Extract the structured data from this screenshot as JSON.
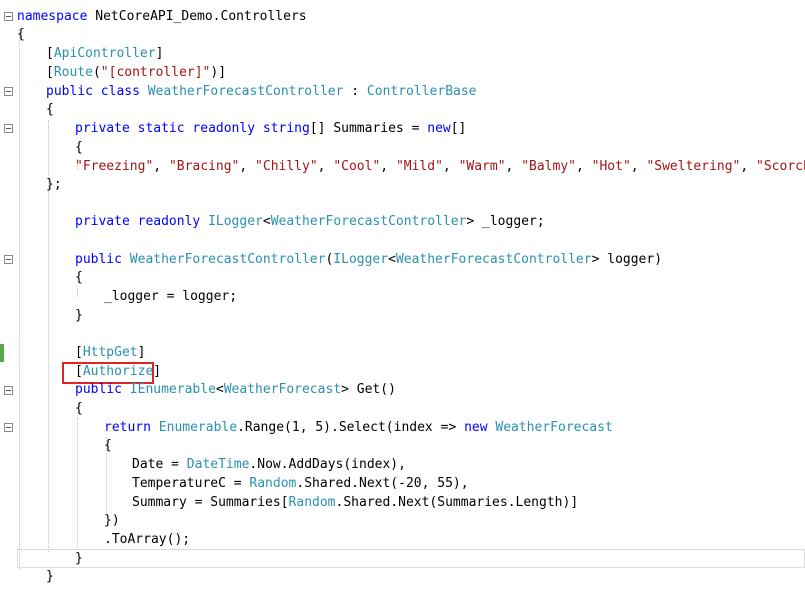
{
  "editor": {
    "colors": {
      "keyword": "#0000ff",
      "type": "#2b91af",
      "string": "#a31515",
      "text": "#000000",
      "highlight_box": "#e02424",
      "change_indicator": "#57a64a"
    },
    "lines": [
      {
        "text_a": "namespace",
        "text_b": " NetCoreAPI_Demo.Controllers"
      },
      {
        "text": "{"
      },
      {
        "p1": "[",
        "t1": "ApiController",
        "p2": "]"
      },
      {
        "p1": "[",
        "t1": "Route",
        "p2": "(",
        "s1": "\"[controller]\"",
        "p3": ")]"
      },
      {
        "k1": "public",
        "k2": "class",
        "t1": "WeatherForecastController",
        "p1": " : ",
        "t2": "ControllerBase"
      },
      {
        "text": "{"
      },
      {
        "k1": "private",
        "k2": "static",
        "k3": "readonly",
        "k4": "string",
        "p1": "[] Summaries = ",
        "k5": "new",
        "p2": "[]"
      },
      {
        "text": "{"
      },
      {
        "s1": "\"Freezing\"",
        "s2": "\"Bracing\"",
        "s3": "\"Chilly\"",
        "s4": "\"Cool\"",
        "s5": "\"Mild\"",
        "s6": "\"Warm\"",
        "s7": "\"Balmy\"",
        "s8": "\"Hot\"",
        "s9": "\"Sweltering\"",
        "s10": "\"Scorching\""
      },
      {
        "text": "};"
      },
      {
        "k1": "private",
        "k2": "readonly",
        "t1": "ILogger",
        "p1": "<",
        "t2": "WeatherForecastController",
        "p2": "> _logger;"
      },
      {
        "k1": "public",
        "t1": "WeatherForecastController",
        "p1": "(",
        "t2": "ILogger",
        "p2": "<",
        "t3": "WeatherForecastController",
        "p3": "> logger)"
      },
      {
        "text": "{"
      },
      {
        "text": "_logger = logger;"
      },
      {
        "text": "}"
      },
      {
        "p1": "[",
        "t1": "HttpGet",
        "p2": "]"
      },
      {
        "p1": "[",
        "t1": "Authorize",
        "p2": "]"
      },
      {
        "k1": "public",
        "t1": "IEnumerable",
        "p1": "<",
        "t2": "WeatherForecast",
        "p2": "> Get()"
      },
      {
        "text": "{"
      },
      {
        "k1": "return",
        "t1": "Enumerable",
        "p1": ".Range(1, 5).Select(index => ",
        "k2": "new",
        "t2": "WeatherForecast"
      },
      {
        "text": "{"
      },
      {
        "p1": "Date = ",
        "t1": "DateTime",
        "p2": ".Now.AddDays(index),"
      },
      {
        "p1": "TemperatureC = ",
        "t1": "Random",
        "p2": ".Shared.Next(-20, 55),"
      },
      {
        "p1": "Summary = Summaries[",
        "t1": "Random",
        "p2": ".Shared.Next(Summaries.Length)]"
      },
      {
        "text": "})"
      },
      {
        "text": ".ToArray();"
      },
      {
        "text": "}"
      },
      {
        "text": "}"
      }
    ]
  }
}
